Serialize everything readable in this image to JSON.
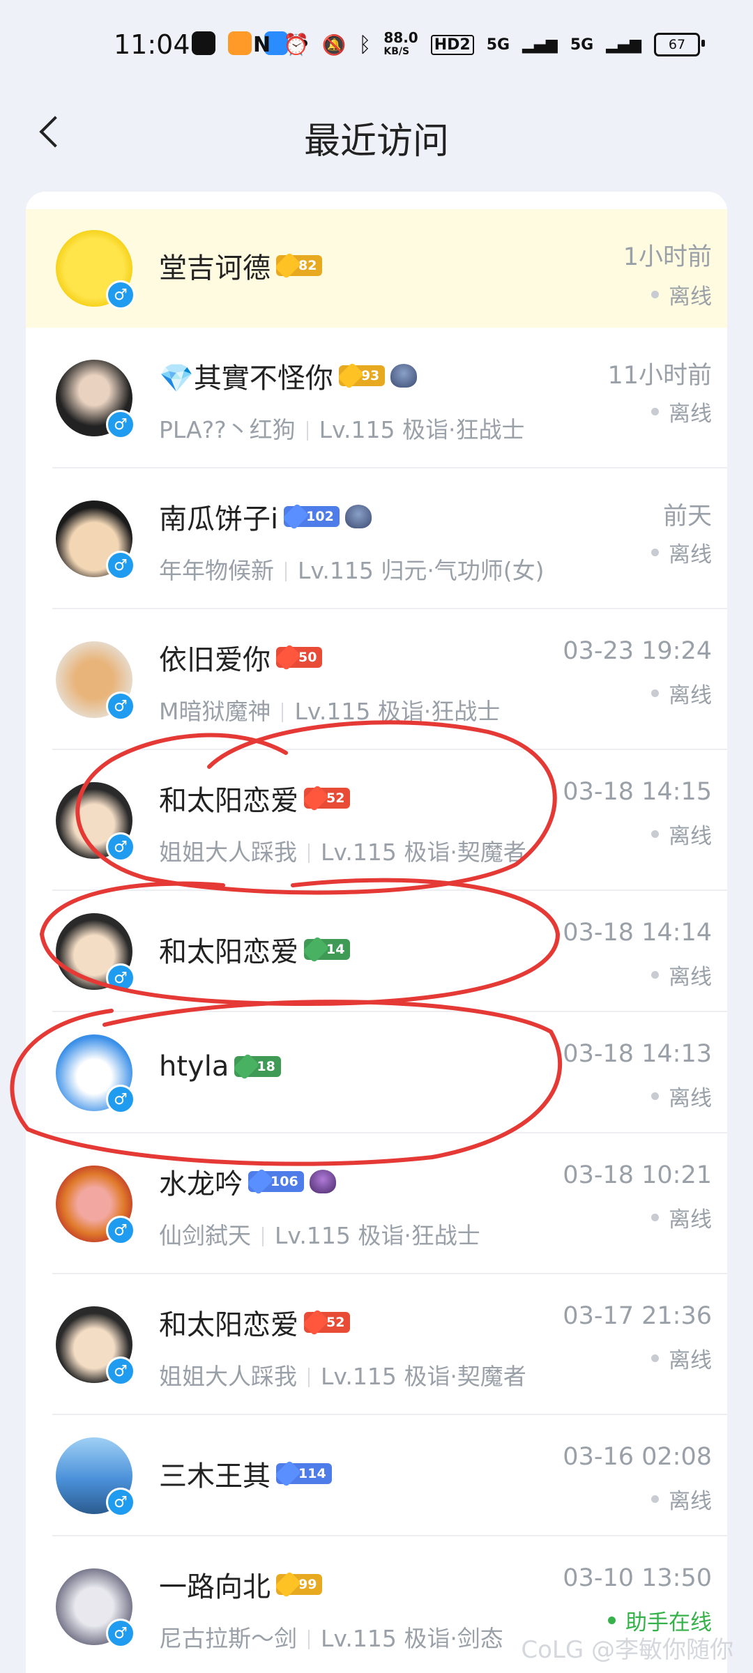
{
  "status_bar": {
    "time": "11:04",
    "speed_value": "88.0",
    "speed_unit": "KB/S",
    "hd_label": "HD2",
    "net1": "5G",
    "net2": "5G",
    "battery": "67"
  },
  "header": {
    "title": "最近访问",
    "back_icon": "chevron-left-icon"
  },
  "rows": [
    {
      "name": "堂吉诃德",
      "level": "82",
      "badge": "gold-crown",
      "sub": "",
      "time": "1小时前",
      "status": "离线"
    },
    {
      "name_prefix": "💎",
      "name": "其實不怪你",
      "level": "93",
      "badge": "gold-crown",
      "sub_a": "PLA??丶红狗",
      "sub_b": "Lv.115 极诣·狂战士",
      "time": "11小时前",
      "status": "离线"
    },
    {
      "name": "南瓜饼子i",
      "level": "102",
      "badge": "blue-diamond",
      "sub_a": "年年物候新",
      "sub_b": "Lv.115 归元·气功师(女)",
      "time": "前天",
      "status": "离线"
    },
    {
      "name": "依旧爱你",
      "level": "50",
      "badge": "red-star",
      "sub_a": "M暗狱魔神",
      "sub_b": "Lv.115 极诣·狂战士",
      "time": "03-23 19:24",
      "status": "离线"
    },
    {
      "name": "和太阳恋爱",
      "level": "52",
      "badge": "red-star",
      "sub_a": "姐姐大人踩我",
      "sub_b": "Lv.115 极诣·契魔者",
      "time": "03-18 14:15",
      "status": "离线"
    },
    {
      "name": "和太阳恋爱",
      "level": "14",
      "badge": "green-star",
      "sub": "",
      "time": "03-18 14:14",
      "status": "离线"
    },
    {
      "name": "htyla",
      "level": "18",
      "badge": "green-star",
      "sub": "",
      "time": "03-18 14:13",
      "status": "离线"
    },
    {
      "name": "水龙吟",
      "level": "106",
      "badge": "blue-diamond",
      "sub_a": "仙剑弑天",
      "sub_b": "Lv.115 极诣·狂战士",
      "time": "03-18 10:21",
      "status": "离线"
    },
    {
      "name": "和太阳恋爱",
      "level": "52",
      "badge": "red-star",
      "sub_a": "姐姐大人踩我",
      "sub_b": "Lv.115 极诣·契魔者",
      "time": "03-17 21:36",
      "status": "离线"
    },
    {
      "name": "三木王其",
      "level": "114",
      "badge": "blue-diamond",
      "sub": "",
      "time": "03-16 02:08",
      "status": "离线"
    },
    {
      "name": "一路向北",
      "level": "99",
      "badge": "gold-crown",
      "sub_a": "尼古拉斯～剑",
      "sub_b": "Lv.115 极诣·剑态",
      "time": "03-10 13:50",
      "status": "助手在线"
    }
  ],
  "gender_symbol": "♂",
  "watermark": "CoLG @李敏你随你",
  "colors": {
    "accent_gender": "#1f9bf0",
    "annotation_red": "#e53935",
    "online_green": "#36b24b",
    "highlight_row": "#fffbe0"
  }
}
